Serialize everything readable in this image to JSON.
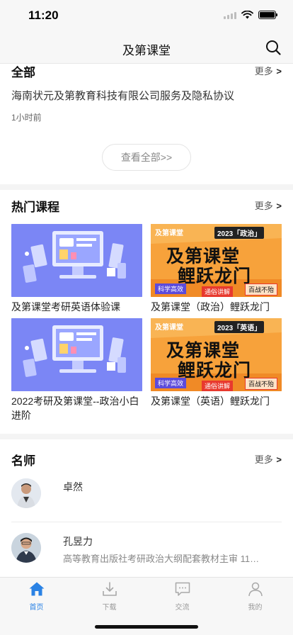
{
  "status_bar": {
    "time": "11:20"
  },
  "nav": {
    "title": "及第课堂"
  },
  "notices": {
    "title": "全部",
    "more_label": "更多",
    "more_arrow": ">",
    "item_title": "海南状元及第教育科技有限公司服务及隐私协议",
    "item_time": "1小时前",
    "view_all": "查看全部>>"
  },
  "hot_courses": {
    "title": "热门课程",
    "more_label": "更多",
    "more_arrow": ">",
    "items": [
      {
        "title": "及第课堂考研英语体验课",
        "thumb": "illustration"
      },
      {
        "title": "及第课堂（政治）鲤跃龙门",
        "thumb": "poster"
      },
      {
        "title": "2022考研及第课堂--政治小白进阶",
        "thumb": "illustration"
      },
      {
        "title": "及第课堂（英语）鲤跃龙门",
        "thumb": "poster"
      }
    ]
  },
  "posters": [
    {
      "brand": "及第课堂",
      "tag": "2023「政治」",
      "line1": "及第课堂",
      "line2": "鲤跃龙门",
      "b1": "科学高效",
      "b2": "通俗讲解",
      "b3": "百战不殆"
    },
    {
      "brand": "及第课堂",
      "tag": "2023「英语」",
      "line1": "及第课堂",
      "line2": "鲤跃龙门",
      "b1": "科学高效",
      "b2": "通俗讲解",
      "b3": "百战不殆"
    }
  ],
  "teachers": {
    "title": "名师",
    "more_label": "更多",
    "more_arrow": ">",
    "items": [
      {
        "name": "卓然",
        "desc": ""
      },
      {
        "name": "孔昱力",
        "desc": "高等教育出版社考研政治大纲配套教材主审 11年…"
      }
    ]
  },
  "tabs": [
    {
      "label": "首页",
      "icon": "home-icon",
      "active": true
    },
    {
      "label": "下载",
      "icon": "download-icon",
      "active": false
    },
    {
      "label": "交流",
      "icon": "chat-icon",
      "active": false
    },
    {
      "label": "我的",
      "icon": "profile-icon",
      "active": false
    }
  ],
  "colors": {
    "accent": "#2a82e4",
    "thumb_blue": "#7b86f5",
    "thumb_orange": "#f7a23b",
    "poster_red": "#e8392e"
  }
}
